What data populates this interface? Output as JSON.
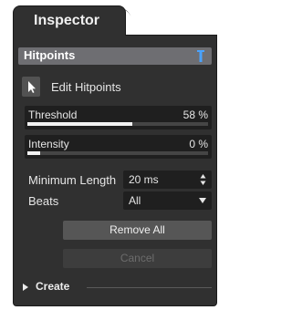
{
  "inspector": {
    "tab_label": "Inspector"
  },
  "section": {
    "title": "Hitpoints",
    "pin_icon": "pin-icon"
  },
  "edit_hitpoints": {
    "label": "Edit Hitpoints",
    "icon": "arrow-cursor-icon"
  },
  "threshold": {
    "label": "Threshold",
    "value": "58 %",
    "level": 0.58
  },
  "intensity": {
    "label": "Intensity",
    "value": "0 %",
    "level": 0.0
  },
  "minimum_length": {
    "label": "Minimum Length",
    "value": "20 ms"
  },
  "beats": {
    "label": "Beats",
    "value": "All"
  },
  "buttons": {
    "remove_all": "Remove All",
    "cancel": "Cancel"
  },
  "create": {
    "label": "Create"
  },
  "colors": {
    "panel": "#303030",
    "header": "#6e6e72",
    "accent": "#4aa3ff"
  }
}
